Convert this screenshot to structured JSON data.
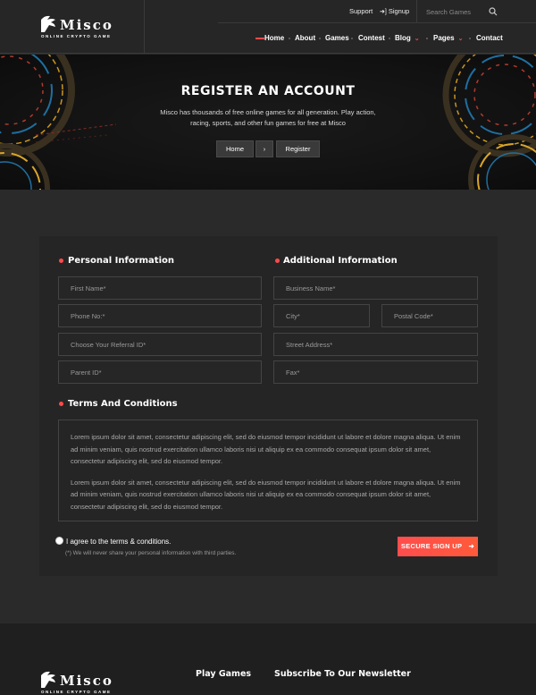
{
  "brand": {
    "name": "Misco",
    "tagline": "ONLINE CRYPTO GAME"
  },
  "topbar": {
    "support": "Support",
    "signup": "Signup",
    "search_placeholder": "Search Games"
  },
  "nav": {
    "items": [
      "Home",
      "About",
      "Games",
      "Contest",
      "Blog",
      "Pages",
      "Contact"
    ],
    "active": "Home"
  },
  "hero": {
    "title": "REGISTER AN ACCOUNT",
    "description": "Misco has thousands of free online games for all generation. Play action, racing, sports, and other fun games for free at Misco",
    "breadcrumb": {
      "home": "Home",
      "separator": "›",
      "current": "Register"
    }
  },
  "form": {
    "personal_title": "Personal Information",
    "additional_title": "Additional Information",
    "personal_fields": [
      "First Name*",
      "Phone No:*",
      "Choose Your Referral ID*",
      "Parent ID*"
    ],
    "business_placeholder": "Business Name*",
    "city_placeholder": "City*",
    "postal_placeholder": "Postal Code*",
    "street_placeholder": "Street Address*",
    "fax_placeholder": "Fax*",
    "terms_title": "Terms And Conditions",
    "terms_p1": "Lorem ipsum dolor sit amet, consectetur adipiscing elit, sed do eiusmod tempor incididunt ut labore et dolore magna aliqua. Ut enim ad minim veniam, quis nostrud exercitation ullamco laboris nisi ut aliquip ex ea commodo consequat ipsum dolor sit amet, consectetur adipiscing elit, sed do eiusmod tempor.",
    "terms_p2": "Lorem ipsum dolor sit amet, consectetur adipiscing elit, sed do eiusmod tempor incididunt ut labore et dolore magna aliqua. Ut enim ad minim veniam, quis nostrud exercitation ullamco laboris nisi ut aliquip ex ea commodo consequat ipsum dolor sit amet, consectetur adipiscing elit, sed do eiusmod tempor.",
    "agree_label": "I agree to the terms & conditions.",
    "agree_note": "(*) We will never share your personal information with third parties.",
    "submit_label": "SECURE SIGN UP"
  },
  "footer": {
    "play_games": "Play Games",
    "newsletter": "Subscribe To Our Newsletter"
  },
  "colors": {
    "accent": "#ff4a4a",
    "background": "#2a2a2a",
    "card": "#252525"
  }
}
